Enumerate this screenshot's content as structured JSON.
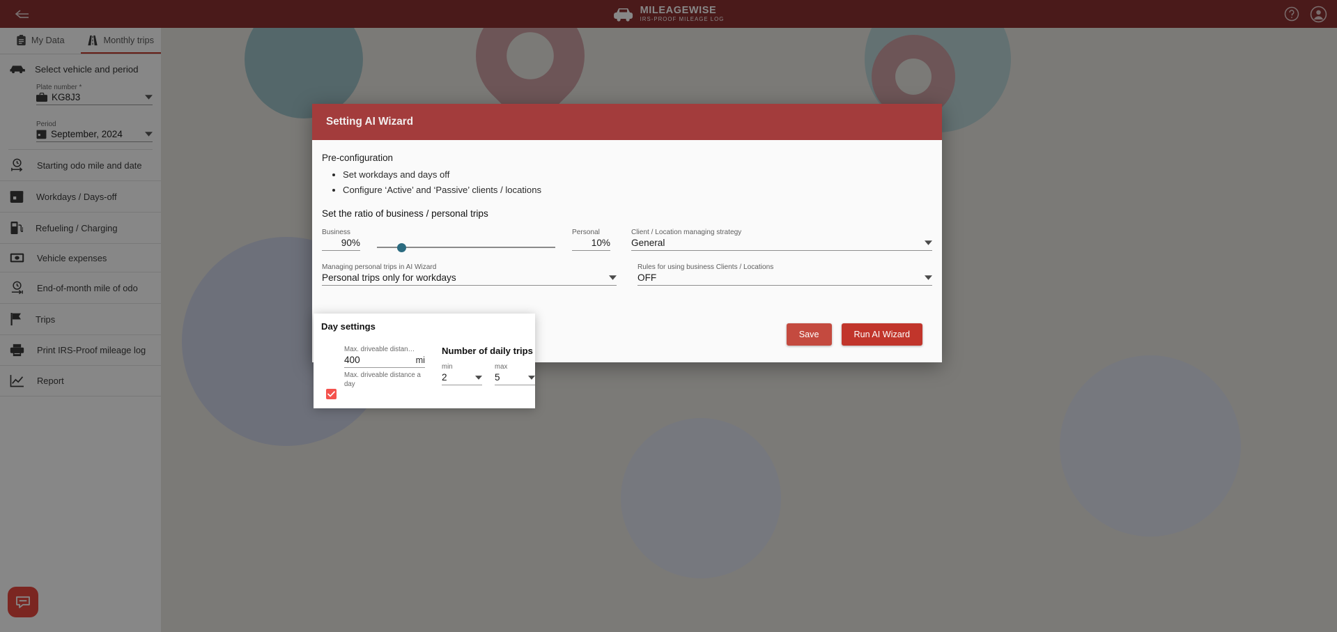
{
  "topbar": {
    "menu_icon": "hamburger-back-icon",
    "brand_name": "MILEAGEWISE",
    "brand_sub": "IRS-PROOF MILEAGE LOG",
    "help_icon": "help-circle-icon",
    "account_icon": "account-circle-icon",
    "color": "#8c3232"
  },
  "tabs": [
    {
      "label": "My Data",
      "icon": "clipboard-icon",
      "active": false
    },
    {
      "label": "Monthly trips",
      "icon": "road-icon",
      "active": true
    }
  ],
  "sidebar": {
    "header": {
      "label": "Select vehicle and period",
      "icon": "car-icon"
    },
    "plate": {
      "label": "Plate number *",
      "value": "KG8J3",
      "icon": "briefcase-icon",
      "caret": "chevron-down-icon"
    },
    "period": {
      "label": "Period",
      "value": "September, 2024",
      "icon": "calendar-icon",
      "caret": "chevron-down-icon"
    },
    "items": [
      {
        "label": "Starting odo mile and date",
        "icon": "clock-start-icon"
      },
      {
        "label": "Workdays / Days-off",
        "icon": "calendar-icon"
      },
      {
        "label": "Refueling / Charging",
        "icon": "fuel-pump-icon"
      },
      {
        "label": "Vehicle expenses",
        "icon": "banknote-icon"
      },
      {
        "label": "End-of-month mile of odo",
        "icon": "clock-end-icon"
      },
      {
        "label": "Trips",
        "icon": "flag-icon"
      },
      {
        "label": "Print IRS-Proof mileage log",
        "icon": "printer-icon"
      },
      {
        "label": "Report",
        "icon": "chart-line-icon"
      }
    ],
    "chat_fab": {
      "icon": "chat-bubble-icon",
      "color": "#e8483f"
    }
  },
  "modal": {
    "title": "Setting AI Wizard",
    "header_color": "#a33c3c",
    "preconfig_title": "Pre-configuration",
    "preconfig_bullets": [
      "Set workdays and days off",
      "Configure ‘Active’ and ‘Passive’ clients / locations"
    ],
    "ratio_title": "Set the ratio of business / personal trips",
    "business": {
      "label": "Business",
      "value": "90%"
    },
    "personal": {
      "label": "Personal",
      "value": "10%"
    },
    "slider": {
      "percent": 11.5,
      "thumb_color": "#2b6b80"
    },
    "strategy": {
      "label": "Client / Location managing strategy",
      "value": "General",
      "caret": "chevron-down-icon"
    },
    "personal_trips": {
      "label": "Managing personal trips in AI Wizard",
      "value": "Personal trips only for workdays",
      "caret": "chevron-down-icon"
    },
    "rules": {
      "label": "Rules for using business Clients / Locations",
      "value": "OFF",
      "caret": "chevron-down-icon"
    },
    "buttons": {
      "save": "Save",
      "run": "Run AI Wizard",
      "save_color": "#c44a3f",
      "run_color": "#c1352b"
    }
  },
  "day_settings": {
    "title": "Day settings",
    "checkbox": {
      "checked": true,
      "color": "#f4524d",
      "icon": "check-icon"
    },
    "distance": {
      "label": "Max. driveable distan…",
      "value": "400",
      "placeholder": "0",
      "unit": "mi",
      "hint": "Max. driveable distance a day"
    },
    "daily_trips": {
      "title": "Number of daily trips",
      "min": {
        "label": "min",
        "value": "2",
        "caret": "chevron-down-icon"
      },
      "max": {
        "label": "max",
        "value": "5",
        "caret": "chevron-down-icon"
      }
    }
  }
}
